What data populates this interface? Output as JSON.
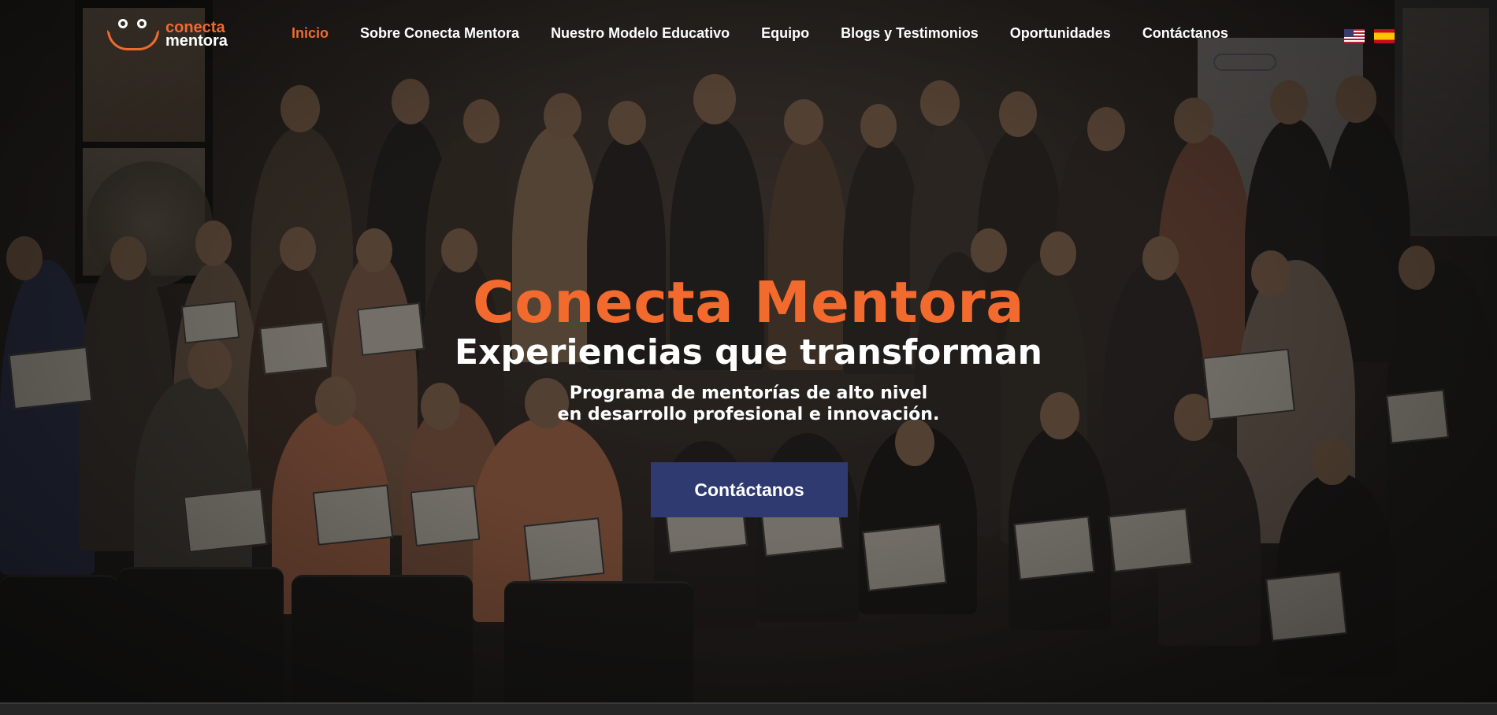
{
  "brand": {
    "line1": "conecta",
    "line2": "mentora",
    "accent_color": "#f26a2e",
    "button_color": "#2e3a70"
  },
  "nav": {
    "items": [
      {
        "label": "Inicio",
        "active": true
      },
      {
        "label": "Sobre Conecta Mentora",
        "active": false
      },
      {
        "label": "Nuestro Modelo Educativo",
        "active": false
      },
      {
        "label": "Equipo",
        "active": false
      },
      {
        "label": "Blogs y Testimonios",
        "active": false
      },
      {
        "label": "Oportunidades",
        "active": false
      },
      {
        "label": "Contáctanos",
        "active": false
      }
    ]
  },
  "languages": [
    {
      "icon": "us-flag-icon"
    },
    {
      "icon": "spain-flag-icon"
    }
  ],
  "hero": {
    "title": "Conecta Mentora",
    "subtitle": "Experiencias que transforman",
    "description_line1": "Programa de mentorías de alto nivel",
    "description_line2": "en desarrollo profesional e innovación.",
    "cta_label": "Contáctanos"
  }
}
